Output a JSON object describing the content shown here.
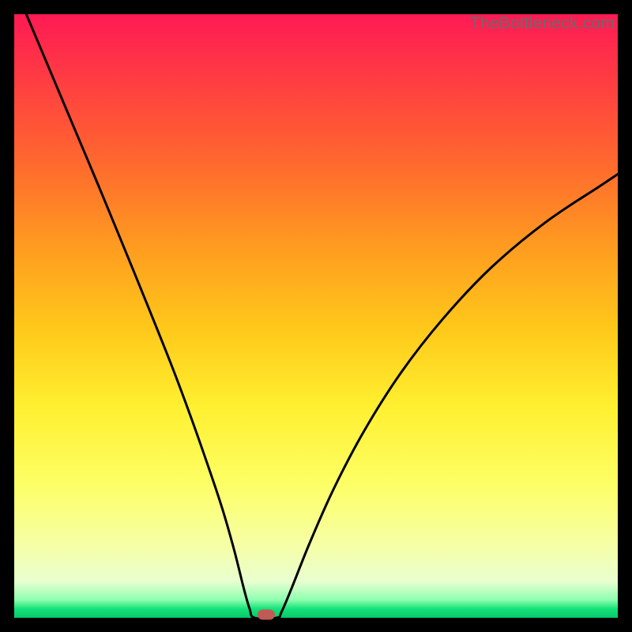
{
  "watermark": "TheBottleneck.com",
  "colors": {
    "curve": "#000000",
    "marker": "#c15a55",
    "frame": "#000000"
  },
  "chart_data": {
    "type": "line",
    "title": "",
    "xlabel": "",
    "ylabel": "",
    "x_range": [
      0,
      100
    ],
    "y_range": [
      0,
      100
    ],
    "series": [
      {
        "name": "bottleneck-curve",
        "description": "V-shaped curve; two arcs meeting at a flat zero segment",
        "points": [
          {
            "x": 2.0,
            "y": 100.0
          },
          {
            "x": 6.0,
            "y": 90.5
          },
          {
            "x": 10.0,
            "y": 81.0
          },
          {
            "x": 14.0,
            "y": 71.5
          },
          {
            "x": 18.0,
            "y": 61.8
          },
          {
            "x": 22.0,
            "y": 52.0
          },
          {
            "x": 26.0,
            "y": 42.0
          },
          {
            "x": 29.0,
            "y": 34.0
          },
          {
            "x": 32.0,
            "y": 25.5
          },
          {
            "x": 34.5,
            "y": 18.0
          },
          {
            "x": 36.5,
            "y": 11.0
          },
          {
            "x": 38.0,
            "y": 5.0
          },
          {
            "x": 39.0,
            "y": 1.5
          },
          {
            "x": 39.8,
            "y": 0.0
          },
          {
            "x": 43.5,
            "y": 0.0
          },
          {
            "x": 44.3,
            "y": 1.0
          },
          {
            "x": 46.0,
            "y": 5.0
          },
          {
            "x": 49.0,
            "y": 12.5
          },
          {
            "x": 53.0,
            "y": 21.5
          },
          {
            "x": 58.0,
            "y": 31.0
          },
          {
            "x": 64.0,
            "y": 40.5
          },
          {
            "x": 71.0,
            "y": 49.5
          },
          {
            "x": 79.0,
            "y": 58.0
          },
          {
            "x": 88.0,
            "y": 65.5
          },
          {
            "x": 97.0,
            "y": 71.5
          },
          {
            "x": 100.0,
            "y": 73.5
          }
        ]
      }
    ],
    "marker": {
      "x": 41.7,
      "y": 0.0,
      "shape": "pill"
    },
    "background_gradient": {
      "direction": "vertical",
      "stops": [
        {
          "pos": 0.0,
          "color": "#ff1a54"
        },
        {
          "pos": 0.25,
          "color": "#ff6a2e"
        },
        {
          "pos": 0.52,
          "color": "#ffc81a"
        },
        {
          "pos": 0.78,
          "color": "#fdff66"
        },
        {
          "pos": 0.94,
          "color": "#e8ffd0"
        },
        {
          "pos": 0.985,
          "color": "#16e27a"
        },
        {
          "pos": 1.0,
          "color": "#06c96b"
        }
      ]
    }
  }
}
